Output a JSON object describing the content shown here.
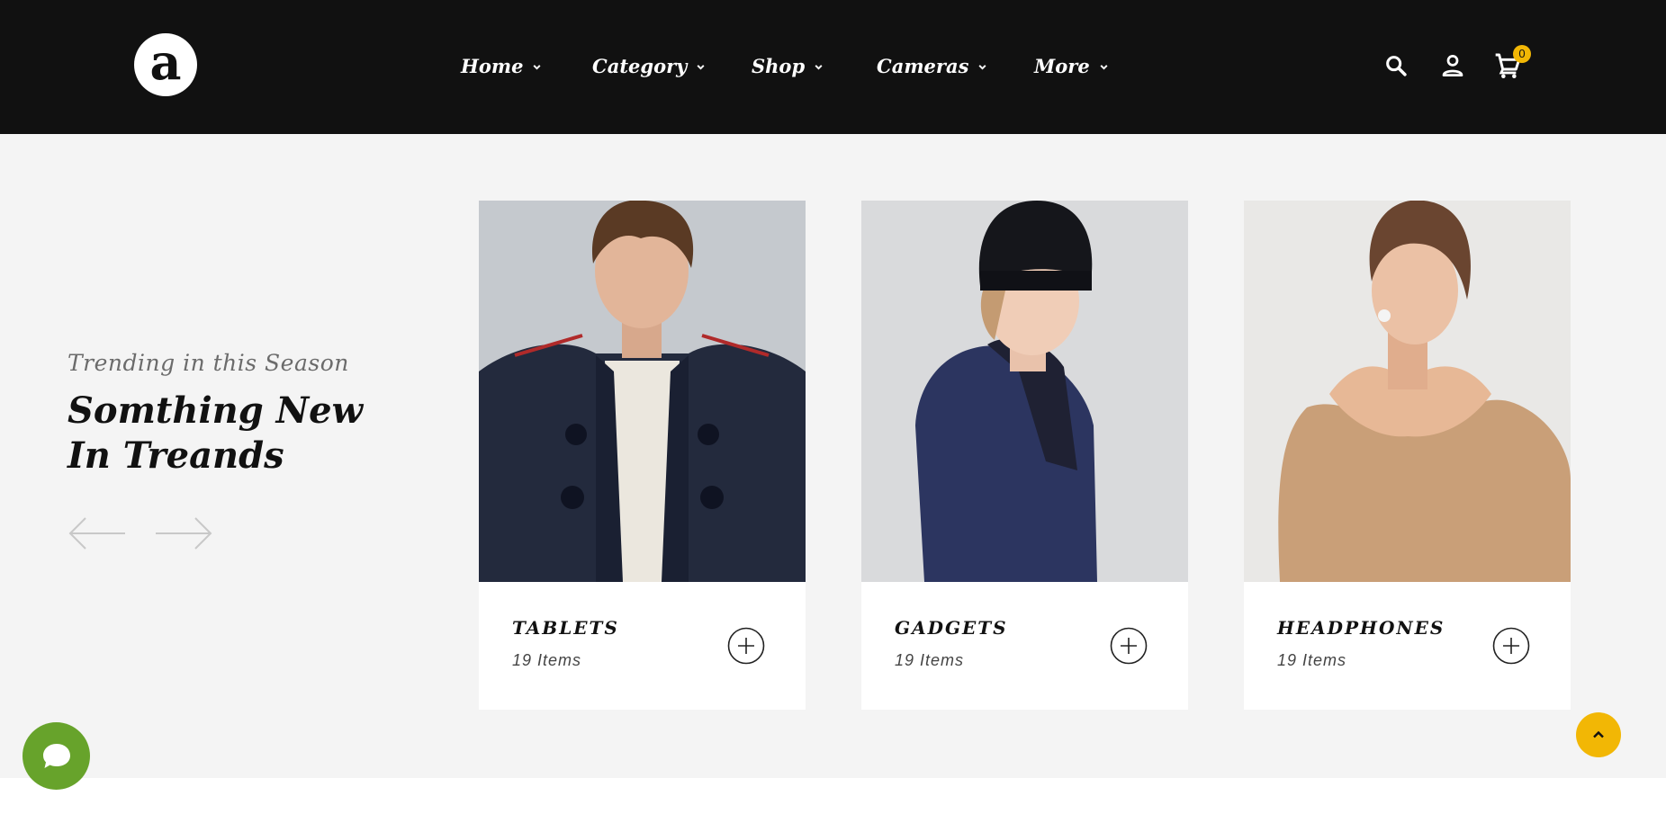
{
  "brand": {
    "logo_letter": "a",
    "logo_icon": "brand-logo-icon"
  },
  "nav": {
    "items": [
      {
        "label": "Home"
      },
      {
        "label": "Category"
      },
      {
        "label": "Shop"
      },
      {
        "label": "Cameras"
      },
      {
        "label": "More"
      }
    ]
  },
  "header_icons": {
    "search": "search-icon",
    "account": "user-icon",
    "cart": "cart-icon",
    "cart_count": "0"
  },
  "hero": {
    "subtitle": "Trending in this Season",
    "title": "Somthing New In Treands"
  },
  "categories": [
    {
      "title": "TABLETS",
      "count": "19 Items",
      "image": "man-in-navy-jacket-photo"
    },
    {
      "title": "GADGETS",
      "count": "19 Items",
      "image": "woman-in-beanie-photo"
    },
    {
      "title": "HEADPHONES",
      "count": "19 Items",
      "image": "woman-in-knit-top-photo"
    }
  ],
  "colors": {
    "header_bg": "#111111",
    "section_bg": "#f4f4f4",
    "accent_yellow": "#f2b705",
    "chat_green": "#67a32b"
  }
}
